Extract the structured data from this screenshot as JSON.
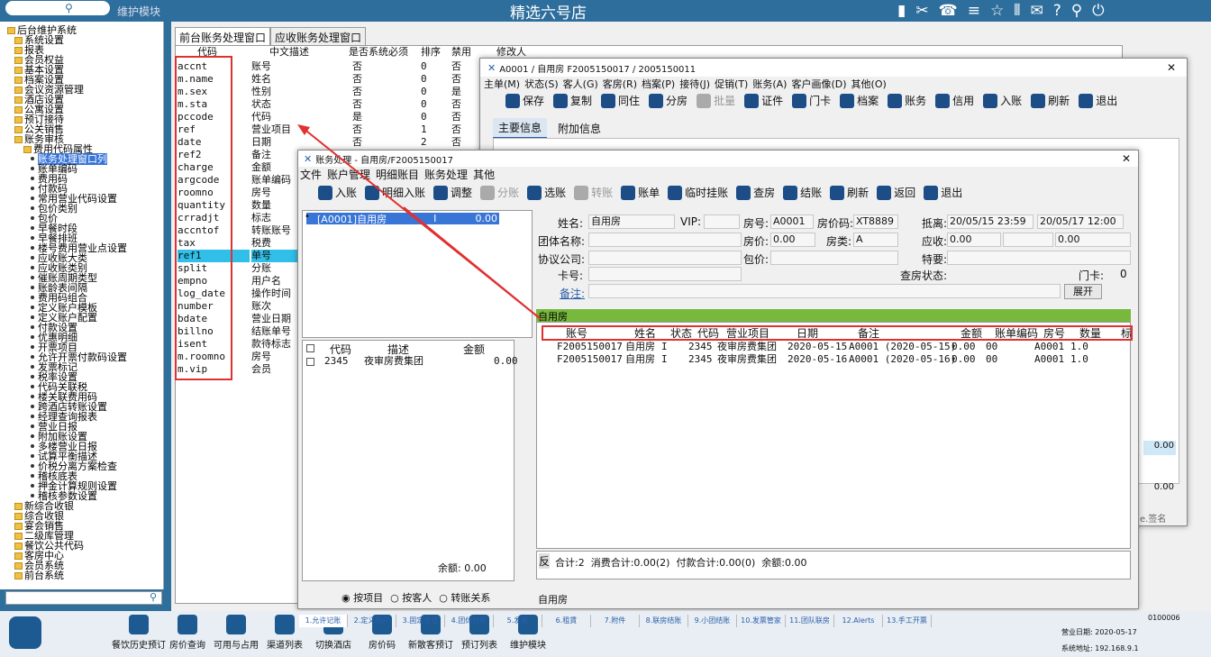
{
  "topbar": {
    "search_placeholder": "维护模块",
    "title": "精选六号店"
  },
  "tree": {
    "root": "后台维护系统",
    "items": [
      "系统设置",
      "报表",
      "会员权益",
      "基本设置",
      "档案设置",
      "会议资源管理",
      "酒店设置",
      "公寓设置",
      "预订接待",
      "公关销售",
      "账务审核",
      "费用代码属性",
      "账务处理窗口列",
      "账单编码",
      "费用码",
      "付款码",
      "常用营业代码设置",
      "包价类别",
      "包价",
      "早餐时段",
      "早餐排班",
      "楼号费用营业点设置",
      "应收账大类",
      "应收账类别",
      "催账周期类型",
      "账龄表间隔",
      "费用码组合",
      "定义账户模板",
      "定义账户配置",
      "付款设置",
      "优惠明细",
      "开票项目",
      "允许开票付款码设置",
      "发票标记",
      "税率设置",
      "代码关联税",
      "楼关联费用码",
      "跨酒店转账设置",
      "经理查询报表",
      "营业日报",
      "附加账设置",
      "多楼营业日报",
      "试算平衡描述",
      "价税分离方案检查",
      "稽核底表",
      "押金计算规则设置",
      "稽核参数设置",
      "新综合收银",
      "综合收银",
      "宴会销售",
      "二级库管理",
      "餐饮公共代码",
      "客房中心",
      "会员系统",
      "前台系统"
    ]
  },
  "leftpanel": {
    "tabs": [
      "前台账务处理窗口",
      "应收账务处理窗口"
    ],
    "headers": [
      "代码",
      "中文描述",
      "是否系统必须",
      "排序",
      "禁用",
      "修改人"
    ],
    "rows": [
      [
        "accnt",
        "账号",
        "否",
        "0",
        "否"
      ],
      [
        "m.name",
        "姓名",
        "否",
        "0",
        "否"
      ],
      [
        "m.sex",
        "性别",
        "否",
        "0",
        "是"
      ],
      [
        "m.sta",
        "状态",
        "否",
        "0",
        "否"
      ],
      [
        "pccode",
        "代码",
        "是",
        "0",
        "否"
      ],
      [
        "ref",
        "营业项目",
        "否",
        "1",
        "否"
      ],
      [
        "date",
        "日期",
        "否",
        "2",
        "否"
      ],
      [
        "ref2",
        "备注",
        "",
        ""
      ],
      [
        "charge",
        "金额",
        "",
        ""
      ],
      [
        "argcode",
        "账单编码",
        "",
        ""
      ],
      [
        "roomno",
        "房号",
        "",
        ""
      ],
      [
        "quantity",
        "数量",
        "",
        ""
      ],
      [
        "crradjt",
        "标志",
        "",
        ""
      ],
      [
        "accntof",
        "转账账号",
        "",
        ""
      ],
      [
        "tax",
        "税费",
        "",
        ""
      ],
      [
        "ref1",
        "单号",
        "",
        ""
      ],
      [
        "split",
        "分账",
        "",
        ""
      ],
      [
        "empno",
        "用户名",
        "",
        ""
      ],
      [
        "log_date",
        "操作时间",
        "",
        ""
      ],
      [
        "number",
        "账次",
        "",
        ""
      ],
      [
        "bdate",
        "营业日期",
        "",
        ""
      ],
      [
        "billno",
        "结账单号",
        "",
        ""
      ],
      [
        "isent",
        "款待标志",
        "",
        ""
      ],
      [
        "m.roomno",
        "房号",
        "",
        ""
      ],
      [
        "m.vip",
        "会员",
        "",
        ""
      ]
    ]
  },
  "guestwin": {
    "title": "A0001 / 自用房 F2005150017 / 2005150011",
    "menu": [
      "主单(M)",
      "状态(S)",
      "客人(G)",
      "客房(R)",
      "档案(P)",
      "接待(J)",
      "促销(T)",
      "账务(A)",
      "客户画像(D)",
      "其他(O)"
    ],
    "toolbar": [
      "保存",
      "复制",
      "同住",
      "分房",
      "批量",
      "证件",
      "门卡",
      "档案",
      "账务",
      "信用",
      "入账",
      "刷新",
      "退出"
    ],
    "tabs": [
      "主要信息",
      "附加信息"
    ],
    "balance": "0.00",
    "balance2": "0.00",
    "sign": "e.签名"
  },
  "acctwin": {
    "title": "账务处理 - 自用房/F2005150017",
    "menu": [
      "文件",
      "账户管理",
      "明细账目",
      "账务处理",
      "其他"
    ],
    "toolbar": [
      "入账",
      "明细入账",
      "调整",
      "分账",
      "选账",
      "转账",
      "账单",
      "临时挂账",
      "查房",
      "结账",
      "刷新",
      "返回",
      "退出"
    ],
    "account_item": "[A0001]自用房",
    "account_flag": "I",
    "account_amt": "0.00",
    "labels": {
      "name": "姓名:",
      "vip": "VIP:",
      "roomno": "房号:",
      "roomprice_code": "房价码:",
      "arrive": "抵离:",
      "group": "团体名称:",
      "roomprice": "房价:",
      "roomtype": "房类:",
      "receivable": "应收:",
      "agreement": "协议公司:",
      "package": "包价:",
      "special": "特要:",
      "card": "卡号:",
      "checkroom": "查房状态:",
      "doorcard": "门卡:",
      "remark": "备注:"
    },
    "values": {
      "name": "自用房",
      "roomno": "A0001",
      "roomprice_code": "XT8889",
      "arrive1": "20/05/15 23:59",
      "arrive2": "20/05/17 12:00",
      "roomprice": "0.00",
      "roomtype": "A",
      "receivable": "0.00",
      "receivable2": "0.00",
      "doorcard": "0",
      "expand": "展开"
    },
    "small_headers": [
      "代码",
      "描述",
      "金额"
    ],
    "small_row": [
      "2345",
      "夜审房费集团",
      "0.00"
    ],
    "small_balance": "余额: 0.00",
    "radio": [
      "按项目",
      "按客人",
      "转账关系"
    ],
    "section": "自用房",
    "grid_headers": [
      "账号",
      "姓名",
      "状态",
      "代码",
      "营业项目",
      "日期",
      "备注",
      "金额",
      "账单编码",
      "房号",
      "数量",
      "标"
    ],
    "grid_rows": [
      [
        "F2005150017",
        "自用房",
        "I",
        "2345",
        "夜审房费集团",
        "2020-05-15",
        "A0001 (2020-05-15)",
        "0.00",
        "00",
        "A0001",
        "1.0"
      ],
      [
        "F2005150017",
        "自用房",
        "I",
        "2345",
        "夜审房费集团",
        "2020-05-16",
        "A0001 (2020-05-16)",
        "0.00",
        "00",
        "A0001",
        "1.0"
      ]
    ],
    "footer_tag": "反",
    "footer": "合计:2  消费合计:0.00(2)  付款合计:0.00(0)  余额:0.00",
    "bottom_tab": "自用房"
  },
  "bottombar": {
    "items": [
      "餐饮历史预订",
      "房价查询",
      "可用与占用",
      "渠道列表",
      "切换酒店",
      "房价码",
      "新散客预订",
      "预订列表",
      "维护模块"
    ],
    "tabs": [
      "1.允许记账",
      "2.定义账户",
      "3.固定支出",
      "4.团体付费",
      "5.发票",
      "6.租賃",
      "7.附件",
      "8.联房结账",
      "9.小团结账",
      "10.发票管家",
      "11.团队联房",
      "12.Alerts",
      "13.手工开票"
    ],
    "status": {
      "id": "0100006",
      "bizdate": "营业日期: 2020-05-17",
      "ip": "系统地址: 192.168.9.1"
    }
  }
}
